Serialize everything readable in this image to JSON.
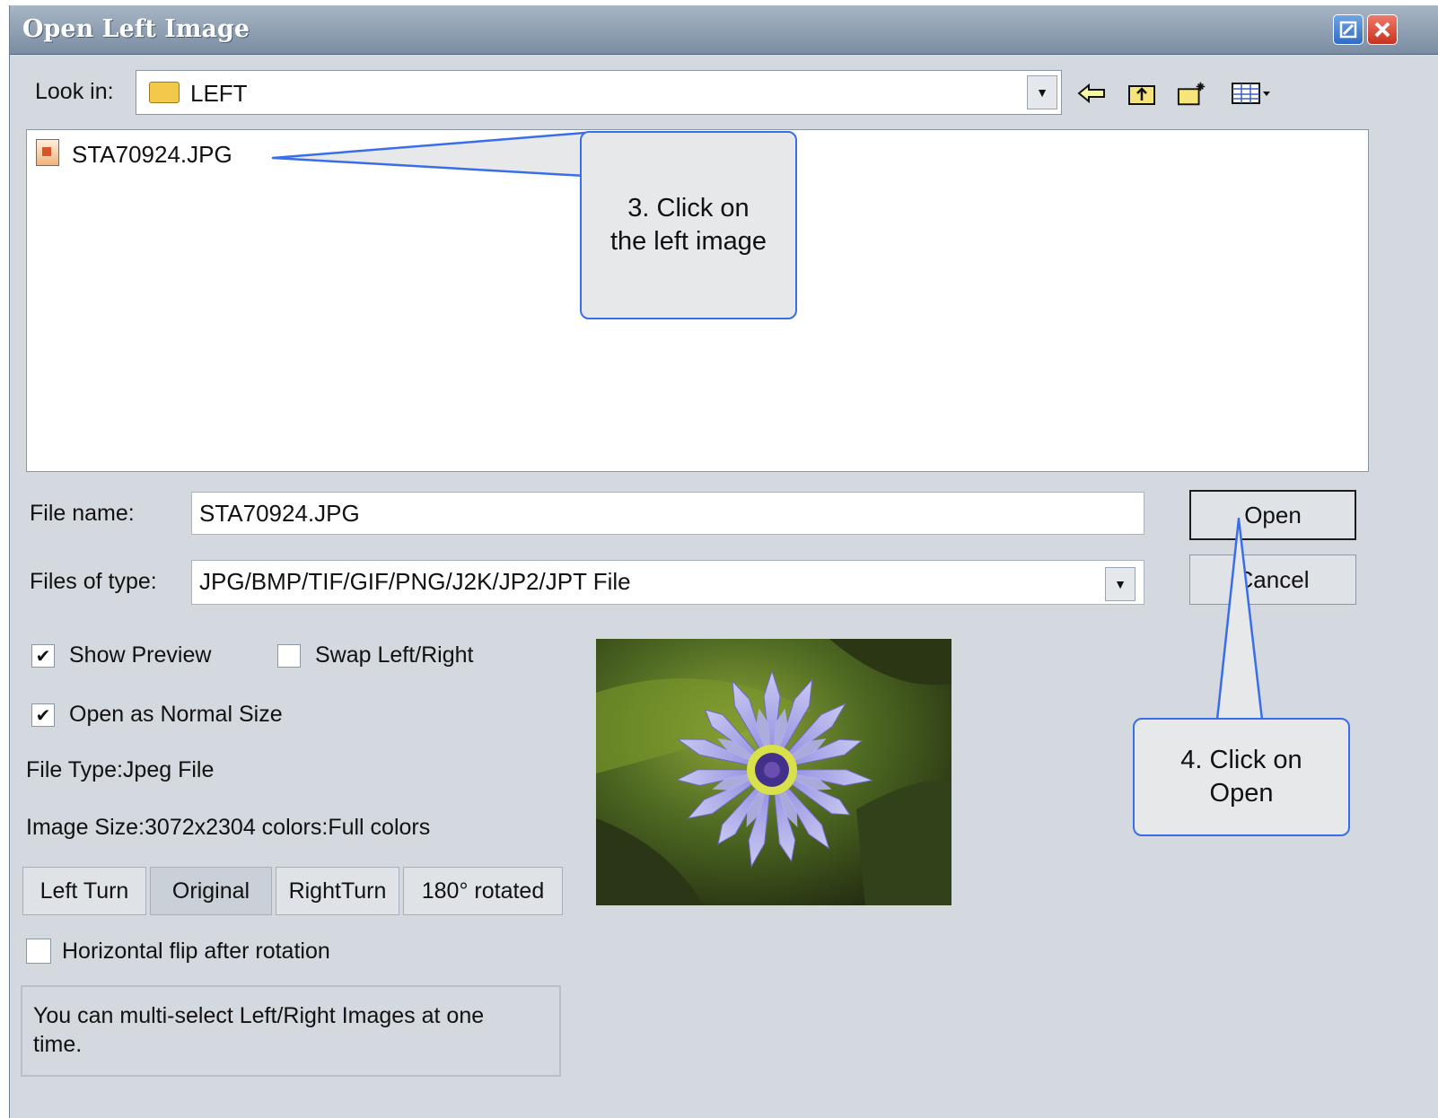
{
  "window": {
    "title": "Open Left Image"
  },
  "look_in": {
    "label": "Look in:",
    "folder": "LEFT"
  },
  "toolbar_icons": [
    "back-arrow-icon",
    "up-folder-icon",
    "new-folder-icon",
    "view-menu-icon"
  ],
  "file_list": {
    "items": [
      {
        "name": "STA70924.JPG",
        "icon": "jpg-file-icon"
      }
    ]
  },
  "file_name": {
    "label": "File name:",
    "value": "STA70924.JPG"
  },
  "files_of_type": {
    "label": "Files of type:",
    "value": "JPG/BMP/TIF/GIF/PNG/J2K/JP2/JPT File"
  },
  "buttons": {
    "open": "Open",
    "cancel": "Cancel"
  },
  "options": {
    "show_preview": {
      "label": "Show Preview",
      "checked": true
    },
    "swap_left_right": {
      "label": "Swap Left/Right",
      "checked": false
    },
    "open_normal_size": {
      "label": "Open as Normal Size",
      "checked": true
    },
    "horizontal_flip": {
      "label": "Horizontal flip after rotation",
      "checked": false
    }
  },
  "info": {
    "file_type": "File Type:Jpeg File",
    "image_size": "Image Size:3072x2304  colors:Full colors"
  },
  "rotation_buttons": [
    {
      "label": "Left Turn",
      "active": false
    },
    {
      "label": "Original",
      "active": true
    },
    {
      "label": "RightTurn",
      "active": false
    },
    {
      "label": "180° rotated",
      "active": false
    }
  ],
  "hint": "You can multi-select Left/Right Images at one time.",
  "callouts": {
    "step3": {
      "line1": "3. Click on",
      "line2": "the left image"
    },
    "step4": {
      "line1": "4. Click on",
      "line2": "Open"
    }
  },
  "colors": {
    "callout_border": "#3a6ee8",
    "dialog_bg": "#d4d9df",
    "titlebar": "#8b9bb0"
  }
}
